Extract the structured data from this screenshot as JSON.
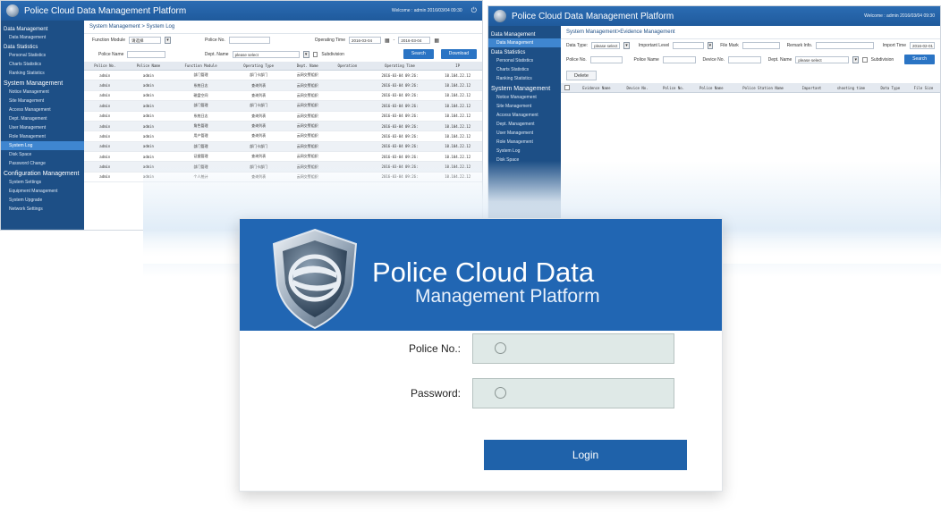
{
  "app_title": "Police Cloud Data Management Platform",
  "left_window": {
    "welcome": "Welcome : admin  2016/03/04 09:30",
    "power_icon": "power-icon",
    "sidebar": [
      {
        "type": "group",
        "label": "Data Management"
      },
      {
        "type": "item",
        "label": "Data Management"
      },
      {
        "type": "group",
        "label": "Data Statistics"
      },
      {
        "type": "item",
        "label": "Personal Statistics"
      },
      {
        "type": "item",
        "label": "Charts Statistics"
      },
      {
        "type": "item",
        "label": "Ranking Statistics"
      },
      {
        "type": "group",
        "label": "System Management",
        "big": true
      },
      {
        "type": "item",
        "label": "Notice Management"
      },
      {
        "type": "item",
        "label": "Site Management"
      },
      {
        "type": "item",
        "label": "Access Management"
      },
      {
        "type": "item",
        "label": "Dept. Management"
      },
      {
        "type": "item",
        "label": "User Management"
      },
      {
        "type": "item",
        "label": "Role Management"
      },
      {
        "type": "item",
        "label": "System Log",
        "active": true
      },
      {
        "type": "item",
        "label": "Disk Space"
      },
      {
        "type": "item",
        "label": "Password Change"
      },
      {
        "type": "group",
        "label": "Configuration Management",
        "big": true
      },
      {
        "type": "item",
        "label": "System Settings"
      },
      {
        "type": "item",
        "label": "Equipment Management"
      },
      {
        "type": "item",
        "label": "System Upgrade"
      },
      {
        "type": "item",
        "label": "Network Settings"
      }
    ],
    "breadcrumb": "System Management > System Log",
    "filters": {
      "function_module_label": "Function Module",
      "function_module_value": "请选择",
      "police_no_label": "Police No.",
      "operating_time_label": "Operating Time",
      "time_from": "2016-03-04",
      "time_sep": "-",
      "time_to": "2016-03-04",
      "police_name_label": "Police Name",
      "dept_name_label": "Dept. Name",
      "dept_name_value": "please select",
      "subdivision_label": "Subdivision",
      "search_button": "Search",
      "download_button": "Download"
    },
    "columns": [
      "Police No.",
      "Police Name",
      "Function Module",
      "Operating Type",
      "Dept. Name",
      "Operation",
      "Operating Time",
      "IP"
    ],
    "rows": [
      [
        "admin",
        "admin",
        "部门管理",
        "部门卡部门",
        "云网交警组织",
        "",
        "2016-03-04 09:26:",
        "10.104.22.12"
      ],
      [
        "admin",
        "admin",
        "系统日志",
        "查询列表",
        "云网交警组织",
        "",
        "2016-03-04 09:26:",
        "10.104.22.12"
      ],
      [
        "admin",
        "admin",
        "磁盘空间",
        "查询列表",
        "云网交警组织",
        "",
        "2016-03-04 09:26:",
        "10.104.22.12"
      ],
      [
        "admin",
        "admin",
        "部门管理",
        "部门卡部门",
        "云网交警组织",
        "",
        "2016-03-04 09:26:",
        "10.104.22.12"
      ],
      [
        "admin",
        "admin",
        "系统日志",
        "查询列表",
        "云网交警组织",
        "",
        "2016-03-04 09:26:",
        "10.104.22.12"
      ],
      [
        "admin",
        "admin",
        "角色管理",
        "查询列表",
        "云网交警组织",
        "",
        "2016-03-04 09:26:",
        "10.104.22.12"
      ],
      [
        "admin",
        "admin",
        "用户管理",
        "查询列表",
        "云网交警组织",
        "",
        "2016-03-04 09:26:",
        "10.104.22.12"
      ],
      [
        "admin",
        "admin",
        "部门管理",
        "部门卡部门",
        "云网交警组织",
        "",
        "2016-03-04 09:26:",
        "10.104.22.12"
      ],
      [
        "admin",
        "admin",
        "证据管理",
        "查询列表",
        "云网交警组织",
        "",
        "2016-03-04 09:26:",
        "10.104.22.12"
      ],
      [
        "admin",
        "admin",
        "部门管理",
        "部门卡部门",
        "云网交警组织",
        "",
        "2016-03-04 09:26:",
        "10.104.22.12"
      ],
      [
        "admin",
        "admin",
        "个人统计",
        "查询列表",
        "云网交警组织",
        "",
        "2016-03-04 09:26:",
        "10.104.22.12"
      ]
    ]
  },
  "right_window": {
    "welcome": "Welcome : admin  2016/03/04 09:30",
    "sidebar": [
      {
        "type": "group",
        "label": "Data Management"
      },
      {
        "type": "item",
        "label": "Data Management",
        "active": true
      },
      {
        "type": "group",
        "label": "Data Statistics"
      },
      {
        "type": "item",
        "label": "Personal Statistics"
      },
      {
        "type": "item",
        "label": "Charts Statistics"
      },
      {
        "type": "item",
        "label": "Ranking Statistics"
      },
      {
        "type": "group",
        "label": "System Management",
        "big": true
      },
      {
        "type": "item",
        "label": "Notice Management"
      },
      {
        "type": "item",
        "label": "Site Management"
      },
      {
        "type": "item",
        "label": "Access Management"
      },
      {
        "type": "item",
        "label": "Dept. Management"
      },
      {
        "type": "item",
        "label": "User Management"
      },
      {
        "type": "item",
        "label": "Role Management"
      },
      {
        "type": "item",
        "label": "System Log"
      },
      {
        "type": "item",
        "label": "Disk Space"
      }
    ],
    "breadcrumb": "System Management>Evidence Management",
    "filters": {
      "data_type_label": "Data Type:",
      "data_type_value": "please select",
      "important_level_label": "Important Level",
      "file_mark_label": "File Mark",
      "remark_info_label": "Remark Info.",
      "import_time_label": "Import Time",
      "import_time_value": "2016-02-01",
      "police_no_label": "Police No.",
      "police_name_label": "Police Name",
      "device_no_label": "Device No.",
      "dept_name_label": "Dept. Name",
      "dept_name_value": "please select",
      "subdivision_label": "Subdivision",
      "search_button": "Search",
      "delete_button": "Delete"
    },
    "columns": [
      "Evidence Name",
      "Device No.",
      "Police No.",
      "Police Name",
      "Police Station Name",
      "Important",
      "shooting time",
      "Data Type",
      "File Size"
    ]
  },
  "login": {
    "title_line1": "Police Cloud Data",
    "title_line2": "Management Platform",
    "police_no_label": "Police No.:",
    "police_no_value": "",
    "password_label": "Password:",
    "password_value": "",
    "login_button": "Login",
    "user_icon": "user-icon",
    "lock_icon": "lock-icon"
  }
}
